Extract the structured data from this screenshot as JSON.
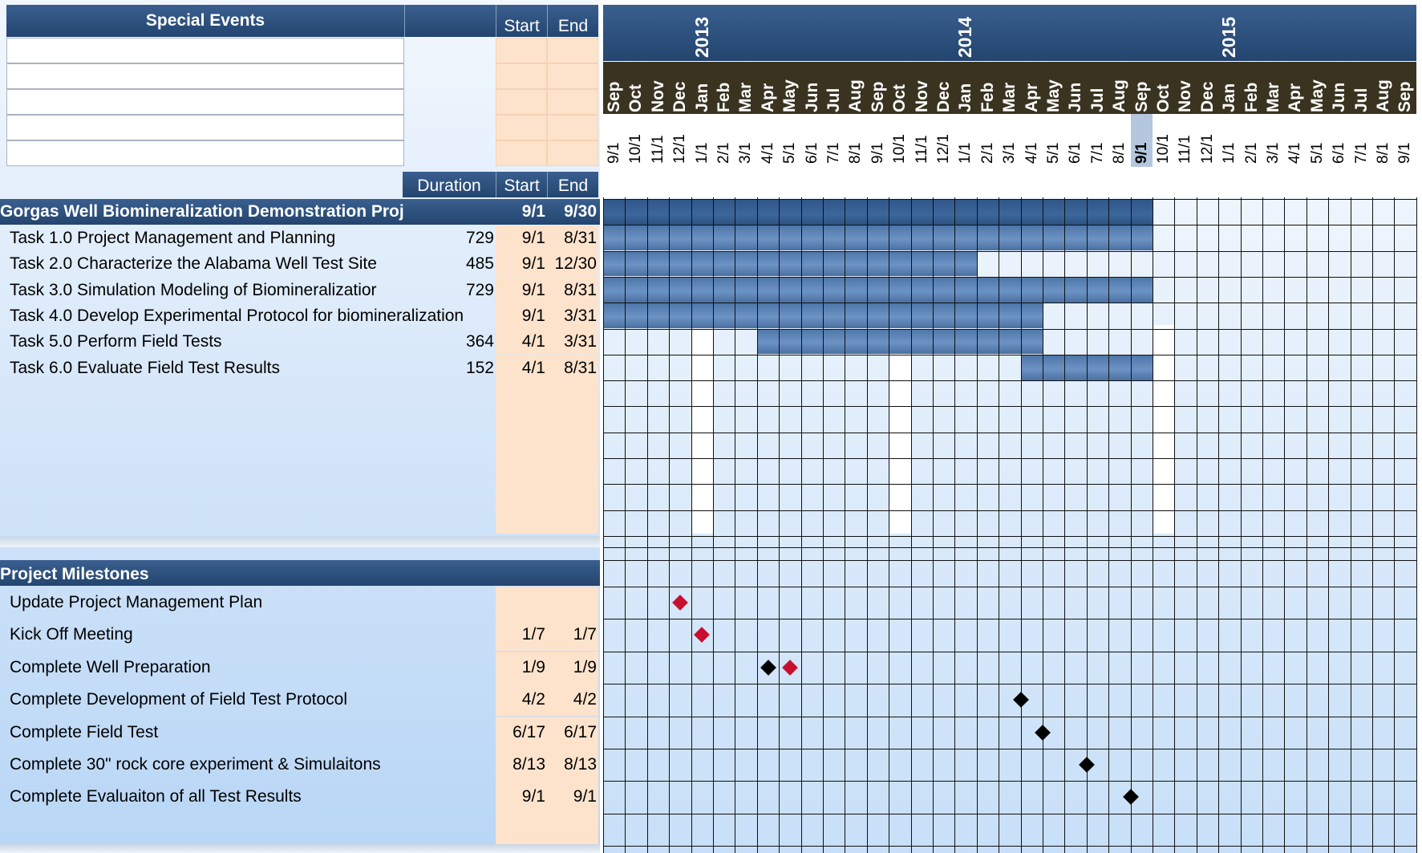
{
  "special_events": {
    "title": "Special Events",
    "start_label": "Start",
    "end_label": "End",
    "rows": 5
  },
  "tasks_header": {
    "duration": "Duration",
    "start": "Start",
    "end": "End"
  },
  "project": {
    "name": "Gorgas Well Biomineralization Demonstration Proj",
    "start": "9/1",
    "end": "9/30",
    "start_index": 0,
    "end_index": 25
  },
  "tasks": [
    {
      "name": "Task 1.0 Project Management and Planning",
      "duration": "729",
      "start": "9/1",
      "end": "8/31",
      "start_index": 0,
      "end_index": 24
    },
    {
      "name": "Task 2.0 Characterize the Alabama Well Test Site",
      "duration": "485",
      "start": "9/1",
      "end": "12/30",
      "start_index": 0,
      "end_index": 16
    },
    {
      "name": "Task 3.0 Simulation Modeling of Biomineralizatior",
      "duration": "729",
      "start": "9/1",
      "end": "8/31",
      "start_index": 0,
      "end_index": 24
    },
    {
      "name": "Task 4.0 Develop Experimental Protocol for biomineralization",
      "duration": "",
      "start": "9/1",
      "end": "3/31",
      "start_index": 0,
      "end_index": 19
    },
    {
      "name": "Task 5.0 Perform Field Tests",
      "duration": "364",
      "start": "4/1",
      "end": "3/31",
      "start_index": 7,
      "end_index": 19
    },
    {
      "name": "Task 6.0 Evaluate Field Test Results",
      "duration": "152",
      "start": "4/1",
      "end": "8/31",
      "start_index": 19,
      "end_index": 24
    }
  ],
  "milestones_header": "Project Milestones",
  "milestones": [
    {
      "name": "Update Project Management Plan",
      "start": "",
      "end": "",
      "marks": [
        {
          "month_index": 3,
          "color": "red"
        }
      ]
    },
    {
      "name": "Kick Off Meeting",
      "start": "1/7",
      "end": "1/7",
      "marks": [
        {
          "month_index": 4,
          "color": "red"
        }
      ]
    },
    {
      "name": "Complete Well Preparation",
      "start": "1/9",
      "end": "1/9",
      "marks": [
        {
          "month_index": 7,
          "color": "black"
        },
        {
          "month_index": 8,
          "color": "red"
        }
      ]
    },
    {
      "name": "Complete Development of Field Test Protocol",
      "start": "4/2",
      "end": "4/2",
      "marks": [
        {
          "month_index": 18.5,
          "color": "black"
        }
      ]
    },
    {
      "name": "Complete Field Test",
      "start": "6/17",
      "end": "6/17",
      "marks": [
        {
          "month_index": 19.5,
          "color": "black"
        }
      ]
    },
    {
      "name": "Complete 30\" rock core experiment & Simulaitons",
      "start": "8/13",
      "end": "8/13",
      "marks": [
        {
          "month_index": 21.5,
          "color": "black"
        }
      ]
    },
    {
      "name": "Complete Evaluaiton of all Test Results",
      "start": "9/1",
      "end": "9/1",
      "marks": [
        {
          "month_index": 23.5,
          "color": "black"
        }
      ]
    }
  ],
  "timeline": {
    "years": [
      {
        "label": "2013",
        "month_index": 4
      },
      {
        "label": "2014",
        "month_index": 16
      },
      {
        "label": "2015",
        "month_index": 28
      }
    ],
    "months": [
      "Sep",
      "Oct",
      "Nov",
      "Dec",
      "Jan",
      "Feb",
      "Mar",
      "Apr",
      "May",
      "Jun",
      "Jul",
      "Aug",
      "Sep",
      "Oct",
      "Nov",
      "Dec",
      "Jan",
      "Feb",
      "Mar",
      "Apr",
      "May",
      "Jun",
      "Jul",
      "Aug",
      "Sep",
      "Oct",
      "Nov",
      "Dec",
      "Jan",
      "Feb",
      "Mar",
      "Apr",
      "May",
      "Jun",
      "Jul",
      "Aug",
      "Sep"
    ],
    "dates": [
      "9/1",
      "10/1",
      "11/1",
      "12/1",
      "1/1",
      "2/1",
      "3/1",
      "4/1",
      "5/1",
      "6/1",
      "7/1",
      "8/1",
      "9/1",
      "10/1",
      "11/1",
      "12/1",
      "1/1",
      "2/1",
      "3/1",
      "4/1",
      "5/1",
      "6/1",
      "7/1",
      "8/1",
      "9/1",
      "10/1",
      "11/1",
      "12/1",
      "1/1",
      "2/1",
      "3/1",
      "4/1",
      "5/1",
      "6/1",
      "7/1",
      "8/1",
      "9/1"
    ],
    "today_index": 24,
    "white_columns": [
      4,
      13,
      25
    ]
  },
  "colors": {
    "header": "#2c4f7c",
    "bar": "#5a82b4",
    "peach": "#fde3cc",
    "milestone_red": "#c8102e",
    "milestone_black": "#000000"
  }
}
